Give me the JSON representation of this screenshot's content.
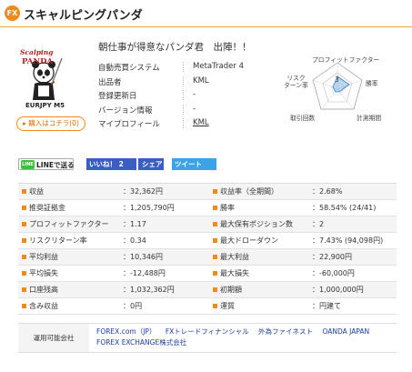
{
  "header": {
    "badge": "FX",
    "title": "スキャルピングパンダ"
  },
  "product": {
    "logo_line1": "Scalping",
    "logo_line2": "PANDA",
    "logo_line3": "EURJPY M5",
    "buy_label": "▸ 購入はコチラ(0)",
    "catchphrase": "朝仕事が得意なパンダ君　出陣！！"
  },
  "info": [
    {
      "label": "自動売買システム",
      "value": "MetaTrader 4"
    },
    {
      "label": "出品者",
      "value": "KML"
    },
    {
      "label": "登録更新日",
      "value": "-"
    },
    {
      "label": "バージョン情報",
      "value": "-"
    },
    {
      "label": "マイプロフィール",
      "value": "KML"
    }
  ],
  "radar": {
    "top": "プロフィットファクター",
    "left_line1": "リスク",
    "left_line2": "ターン率",
    "right": "勝率",
    "bottom_left": "取引回数",
    "bottom_right": "計測期間",
    "center": "3",
    "colors": {
      "grid": "#999999",
      "fill": "#6aa6e0"
    }
  },
  "social": {
    "line_icon": "LINE",
    "line_label": "LINEで送る",
    "like_label": "いいね！ 2",
    "share_label": "シェア",
    "tweet_label": "ツイート"
  },
  "stats": [
    {
      "l": "収益",
      "v": "32,362円",
      "l2": "収益率（全期間）",
      "v2": "2.68%"
    },
    {
      "l": "推奨証拠金",
      "v": "1,205,790円",
      "l2": "勝率",
      "v2": "58.54% (24/41)"
    },
    {
      "l": "プロフィットファクター",
      "v": "1.17",
      "l2": "最大保有ポジション数",
      "v2": "2"
    },
    {
      "l": "リスクリターン率",
      "v": "0.34",
      "l2": "最大ドローダウン",
      "v2": "7.43% (94,098円)"
    },
    {
      "l": "平均利益",
      "v": "10,346円",
      "l2": "最大利益",
      "v2": "22,900円"
    },
    {
      "l": "平均損失",
      "v": "-12,488円",
      "l2": "最大損失",
      "v2": "-60,000円"
    },
    {
      "l": "口座残高",
      "v": "1,032,362円",
      "l2": "初期額",
      "v2": "1,000,000円"
    },
    {
      "l": "含み収益",
      "v": "0円",
      "l2": "運質",
      "v2": "円建て"
    }
  ],
  "brokers": {
    "label": "運用可能会社",
    "items": [
      "FOREX.com（JP）",
      "FXトレードフィナンシャル",
      "外為ファイネスト",
      "OANDA JAPAN",
      "FOREX EXCHANGE株式会社"
    ]
  },
  "accent_color": "#f08a1a"
}
